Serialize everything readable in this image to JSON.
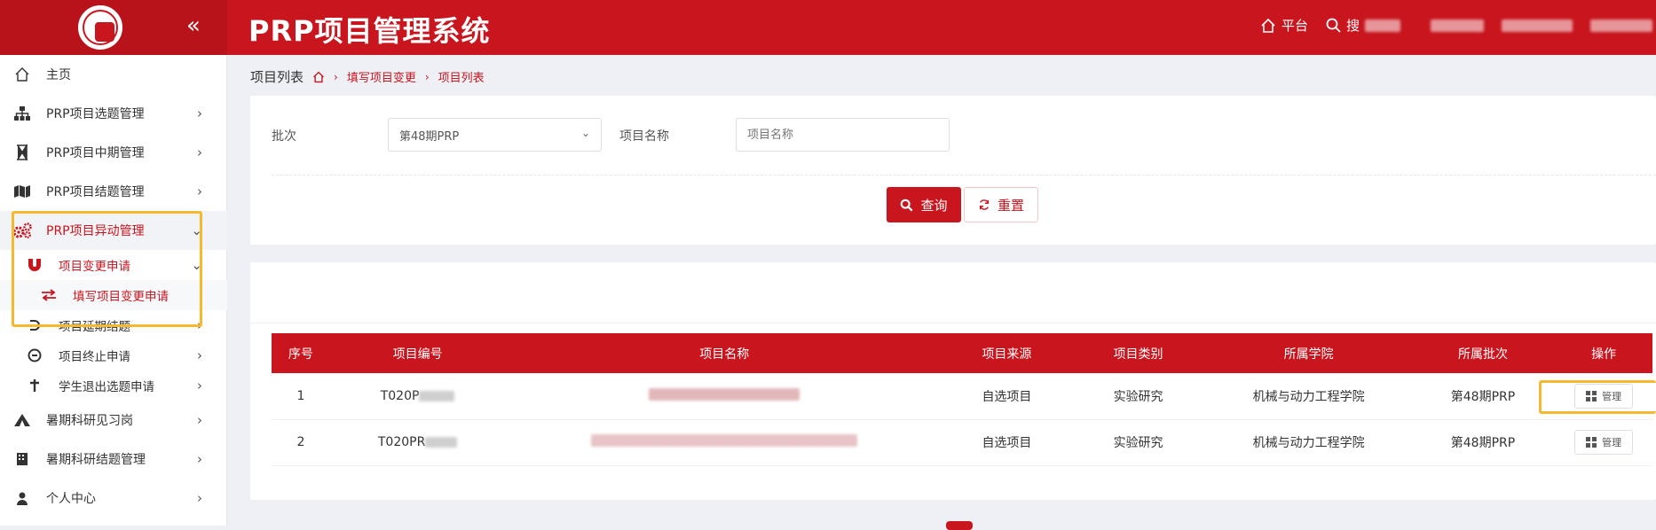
{
  "header": {
    "title": "PRP项目管理系统",
    "platform_label": "平台",
    "search_label": "搜"
  },
  "sidebar": {
    "collapse_icon": "double-chevron-left",
    "items": [
      {
        "label": "主页",
        "icon": "home-icon"
      },
      {
        "label": "PRP项目选题管理",
        "icon": "sitemap-icon"
      },
      {
        "label": "PRP项目中期管理",
        "icon": "hourglass-icon"
      },
      {
        "label": "PRP项目结题管理",
        "icon": "map-icon"
      },
      {
        "label": "PRP项目异动管理",
        "icon": "gears-icon"
      },
      {
        "label": "项目变更申请",
        "icon": "magnet-icon"
      },
      {
        "label": "填写项目变更申请",
        "icon": "exchange-icon"
      },
      {
        "label": "项目延期结题",
        "icon": "undo-icon"
      },
      {
        "label": "项目终止申请",
        "icon": "stop-icon"
      },
      {
        "label": "学生退出选题申请",
        "icon": "cross-icon"
      },
      {
        "label": "暑期科研见习岗",
        "icon": "tent-icon"
      },
      {
        "label": "暑期科研结题管理",
        "icon": "building-icon"
      },
      {
        "label": "个人中心",
        "icon": "user-icon"
      }
    ]
  },
  "breadcrumb": {
    "current": "项目列表",
    "path1": "填写项目变更",
    "path2": "项目列表"
  },
  "filter": {
    "batch_label": "批次",
    "batch_value": "第48期PRP",
    "name_label": "项目名称",
    "name_placeholder": "项目名称",
    "query_label": "查询",
    "reset_label": "重置"
  },
  "table": {
    "columns": [
      "序号",
      "项目编号",
      "项目名称",
      "项目来源",
      "项目类别",
      "所属学院",
      "所属批次",
      "操作"
    ],
    "rows": [
      {
        "no": "1",
        "code": "T020P",
        "source": "自选项目",
        "category": "实验研究",
        "college": "机械与动力工程学院",
        "batch": "第48期PRP",
        "action": "管理"
      },
      {
        "no": "2",
        "code": "T020PR",
        "source": "自选项目",
        "category": "实验研究",
        "college": "机械与动力工程学院",
        "batch": "第48期PRP",
        "action": "管理"
      }
    ]
  },
  "colors": {
    "brand": "#c8151e",
    "highlight": "#f5b82e"
  }
}
